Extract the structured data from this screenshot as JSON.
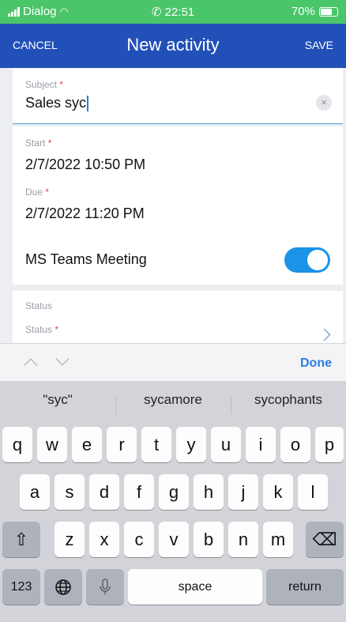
{
  "status_bar": {
    "carrier": "Dialog",
    "time": "22:51",
    "battery": "70%"
  },
  "nav": {
    "cancel": "CANCEL",
    "title": "New activity",
    "save": "SAVE"
  },
  "form": {
    "subject": {
      "label": "Subject",
      "required": "*",
      "value": "Sales syc",
      "clear": "×"
    },
    "start": {
      "label": "Start",
      "required": "*",
      "value": "2/7/2022 10:50 PM"
    },
    "due": {
      "label": "Due",
      "required": "*",
      "value": "2/7/2022 11:20 PM"
    },
    "teams": {
      "label": "MS Teams Meeting",
      "on": true
    },
    "status_section": "Status",
    "status": {
      "label": "Status",
      "required": "*"
    }
  },
  "keyboard_toolbar": {
    "done": "Done"
  },
  "suggestions": [
    "\"syc\"",
    "sycamore",
    "sycophants"
  ],
  "keys": {
    "row1": [
      "q",
      "w",
      "e",
      "r",
      "t",
      "y",
      "u",
      "i",
      "o",
      "p"
    ],
    "row2": [
      "a",
      "s",
      "d",
      "f",
      "g",
      "h",
      "j",
      "k",
      "l"
    ],
    "row3": [
      "z",
      "x",
      "c",
      "v",
      "b",
      "n",
      "m"
    ],
    "numbers": "123",
    "space": "space",
    "return": "return",
    "shift": "⇧",
    "delete": "⌫"
  },
  "colors": {
    "status_bar": "#4bc56a",
    "nav": "#2250b9",
    "accent": "#2a7de1",
    "toggle": "#1a93e8"
  }
}
